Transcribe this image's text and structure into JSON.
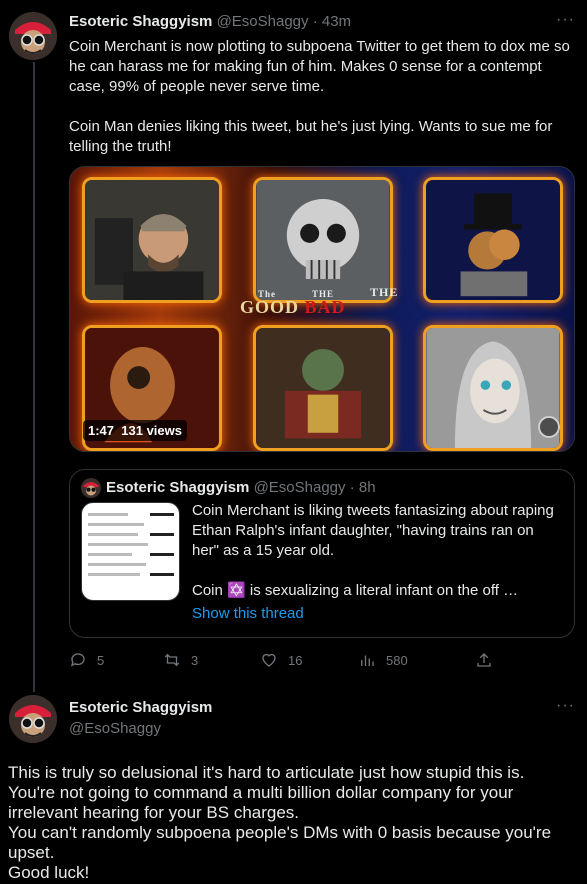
{
  "tweet1": {
    "author_name": "Esoteric Shaggyism",
    "author_handle": "@EsoShaggy",
    "separator": "·",
    "time": "43m",
    "more_icon": "···",
    "body": "Coin Merchant is now plotting to subpoena Twitter to get them to dox me so he can harass me for making fun of him. Makes 0 sense for a contempt case, 99% of people never serve time.\n\nCoin Man denies liking this tweet, but he's just lying. Wants to sue me for telling the truth!",
    "media": {
      "banner_the1": "The",
      "banner_good": "GOOD",
      "banner_the2": "THE",
      "banner_bad": "BAD",
      "banner_the3": "THE",
      "duration": "1:47",
      "views": "131 views"
    },
    "quote": {
      "author_name": "Esoteric Shaggyism",
      "author_handle": "@EsoShaggy",
      "separator": "·",
      "time": "8h",
      "body": "Coin Merchant is liking tweets fantasizing about raping Ethan Ralph's infant daughter, \"having trains ran on her\" as a 15 year old.\n\nCoin ✡️ is sexualizing a literal infant on the off …",
      "show_thread": "Show this thread"
    },
    "actions": {
      "replies": "5",
      "retweets": "3",
      "likes": "16",
      "views": "580"
    }
  },
  "tweet2": {
    "author_name": "Esoteric Shaggyism",
    "author_handle": "@EsoShaggy",
    "more_icon": "···",
    "body": "This is truly so delusional it's hard to articulate just how stupid this is.\nYou're not going to command a multi billion dollar company for your irrelevant hearing for your BS charges.\nYou can't randomly subpoena people's DMs with 0 basis because you're upset.\nGood luck!"
  },
  "colors": {
    "background": "#000000",
    "text": "#e7e9ea",
    "muted": "#71767b",
    "link": "#1d9bf0",
    "border": "#2f3336"
  }
}
